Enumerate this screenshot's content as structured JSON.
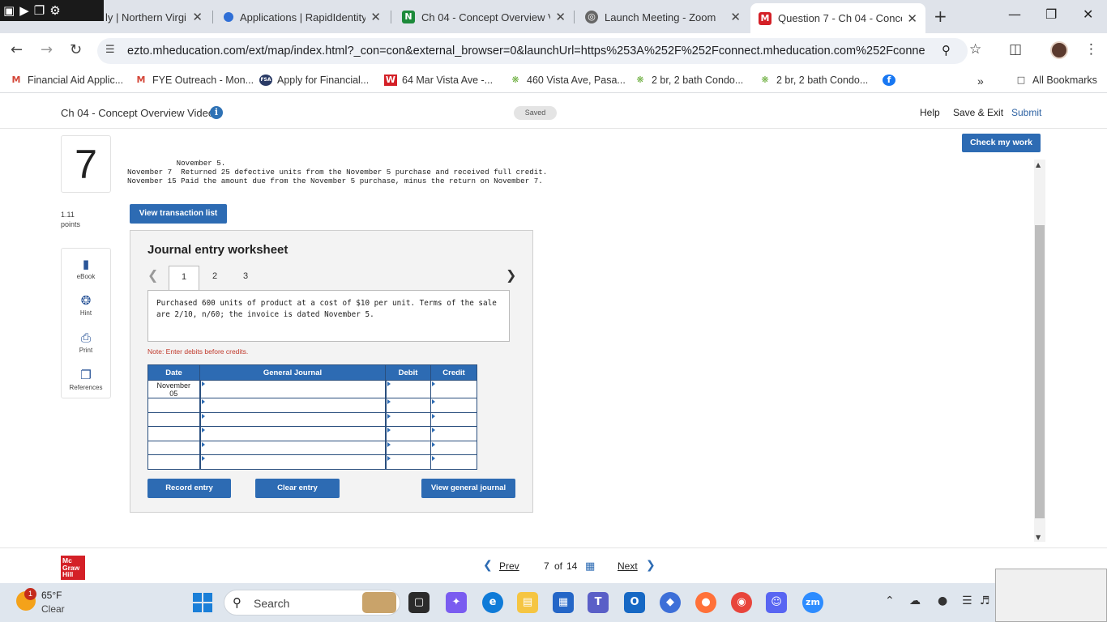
{
  "browser": {
    "tabs": [
      {
        "title": "ly | Northern Virgi",
        "icon": "document-icon"
      },
      {
        "title": "Applications | RapidIdentity",
        "icon": "rapididentity-icon"
      },
      {
        "title": "Ch 04 - Concept Overview V",
        "icon": "n-icon"
      },
      {
        "title": "Launch Meeting - Zoom",
        "icon": "zoom-icon"
      },
      {
        "title": "Question 7 - Ch 04 - Concep",
        "icon": "m-icon"
      }
    ],
    "url": "ezto.mheducation.com/ext/map/index.html?_con=con&external_browser=0&launchUrl=https%253A%252F%252Fconnect.mheducation.com%252Fconnect%25...",
    "bookmarks": [
      "Financial Aid Applic...",
      "FYE Outreach - Mon...",
      "Apply for Financial...",
      "64 Mar Vista Ave -...",
      "460 Vista Ave, Pasa...",
      "2 br, 2 bath Condo...",
      "2 br, 2 bath Condo..."
    ],
    "bookmarks_overflow": "»",
    "all_bookmarks": "All Bookmarks",
    "fsa_badge": "FSA"
  },
  "header": {
    "title": "Ch 04 - Concept Overview Videos",
    "saved": "Saved",
    "help": "Help",
    "save_exit": "Save & Exit",
    "submit": "Submit"
  },
  "question": {
    "number": "7",
    "points_value": "1.11",
    "points_label": "points",
    "check_label": "Check my work",
    "problem_lines": [
      "           November 5.",
      "November 7  Returned 25 defective units from the November 5 purchase and received full credit.",
      "November 15 Paid the amount due from the November 5 purchase, minus the return on November 7."
    ],
    "view_transactions": "View transaction list"
  },
  "sidebar_tools": [
    {
      "label": "eBook",
      "icon": "book-icon"
    },
    {
      "label": "Hint",
      "icon": "lifebuoy-icon"
    },
    {
      "label": "Print",
      "icon": "printer-icon"
    },
    {
      "label": "References",
      "icon": "copy-icon"
    }
  ],
  "worksheet": {
    "title": "Journal entry worksheet",
    "tabs": [
      "1",
      "2",
      "3"
    ],
    "active_tab": "1",
    "description": "Purchased 600 units of product at a cost of $10 per unit. Terms of the sale are 2/10, n/60; the invoice is dated November 5.",
    "note": "Note: Enter debits before credits.",
    "columns": [
      "Date",
      "General Journal",
      "Debit",
      "Credit"
    ],
    "first_date": [
      "November",
      "05"
    ],
    "rows": 6,
    "buttons": {
      "record": "Record entry",
      "clear": "Clear entry",
      "view_journal": "View general journal"
    }
  },
  "footer": {
    "prev": "Prev",
    "current": "7",
    "of": "of",
    "total": "14",
    "next": "Next",
    "logo": [
      "Mc",
      "Graw",
      "Hill"
    ]
  },
  "taskbar": {
    "weather_badge": "1",
    "temperature": "65°F",
    "condition": "Clear",
    "search_label": "Search"
  },
  "colors": {
    "accent": "#2d6bb3",
    "note_red": "#c0392b",
    "brand_red": "#d42027"
  }
}
